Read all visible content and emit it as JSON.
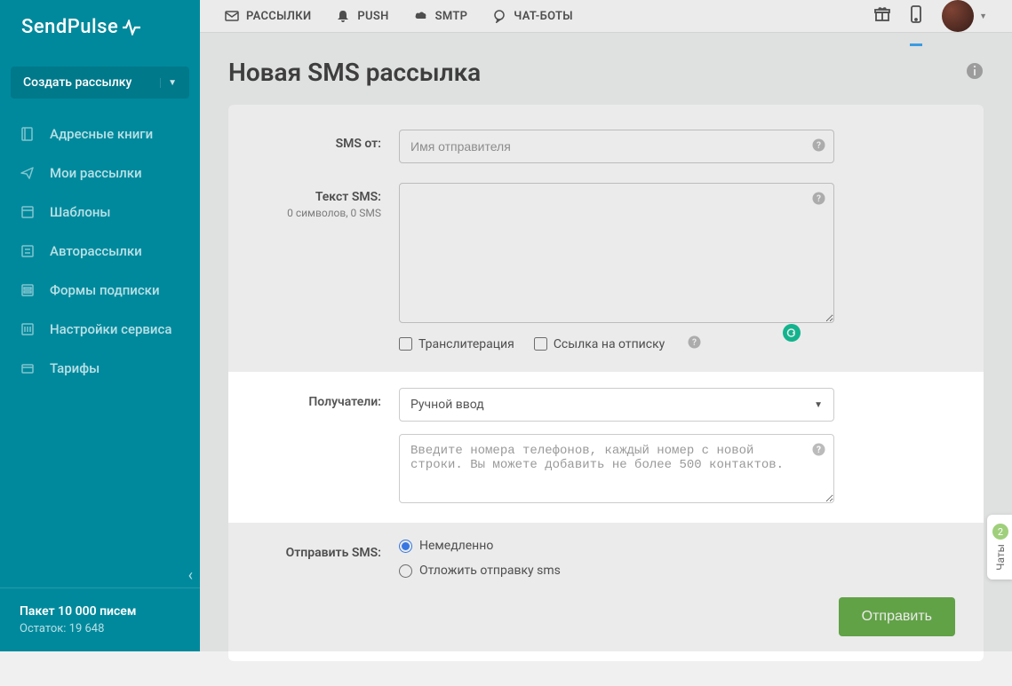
{
  "brand": "SendPulse",
  "sidebar": {
    "create_label": "Создать рассылку",
    "items": [
      {
        "label": "Адресные книги"
      },
      {
        "label": "Мои рассылки"
      },
      {
        "label": "Шаблоны"
      },
      {
        "label": "Авторассылки"
      },
      {
        "label": "Формы подписки"
      },
      {
        "label": "Настройки сервиса"
      },
      {
        "label": "Тарифы"
      }
    ],
    "footer": {
      "plan": "Пакет 10 000 писем",
      "balance": "Остаток: 19 648"
    }
  },
  "topnav": [
    {
      "label": "РАССЫЛКИ"
    },
    {
      "label": "PUSH"
    },
    {
      "label": "SMTP"
    },
    {
      "label": "ЧАТ-БОТЫ"
    }
  ],
  "page": {
    "title": "Новая SMS рассылка",
    "labels": {
      "sms_from": "SMS от:",
      "sms_text": "Текст SMS:",
      "char_count": "0 символов, 0 SMS",
      "recipients": "Получатели:",
      "send_sms": "Отправить SMS:"
    },
    "placeholders": {
      "sender": "Имя отправителя",
      "phones": "Введите номера телефонов, каждый номер с новой строки. Вы можете добавить не более 500 контактов."
    },
    "checkboxes": {
      "translit": "Транслитерация",
      "unsub": "Ссылка на отписку"
    },
    "recipients_select": "Ручной ввод",
    "radios": {
      "immediate": "Немедленно",
      "delayed": "Отложить отправку sms"
    },
    "submit": "Отправить"
  },
  "chat": {
    "count": "2",
    "label": "Чаты"
  }
}
